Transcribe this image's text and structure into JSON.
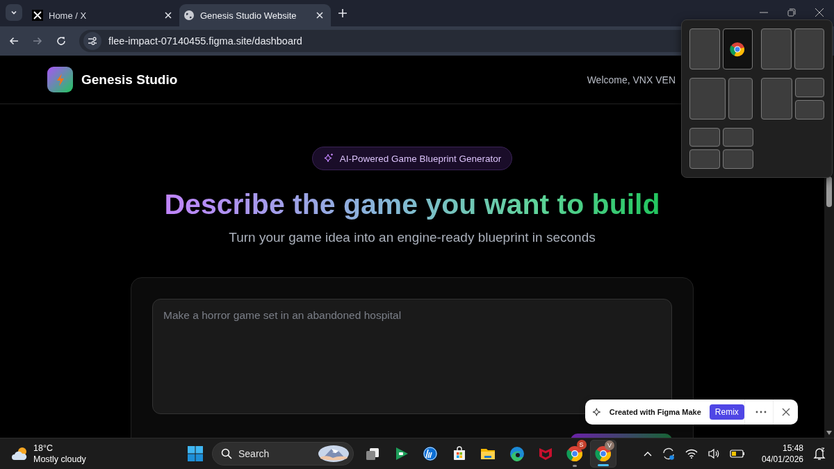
{
  "browser": {
    "tabs": [
      {
        "label": "Home / X",
        "kind": "x",
        "selected": false
      },
      {
        "label": "Genesis Studio Website",
        "kind": "globe",
        "selected": true
      }
    ],
    "address": "flee-impact-07140455.figma.site/dashboard"
  },
  "site": {
    "brand": "Genesis Studio",
    "welcome": "Welcome, VNX VEN",
    "badge": "AI-Powered Game Blueprint Generator",
    "heading": "Describe the game you want to build",
    "subheading": "Turn your game idea into an engine-ready blueprint in seconds",
    "prompt": {
      "placeholder": "Make a horror game set in an abandoned hospital"
    }
  },
  "toast": {
    "text": "Created with Figma Make",
    "button": "Remix"
  },
  "taskbar": {
    "weather": {
      "temperature": "18°C",
      "condition": "Mostly cloudy"
    },
    "search": {
      "placeholder": "Search"
    },
    "apps": [
      {
        "kind": "taskview",
        "running": false,
        "selected": false
      },
      {
        "kind": "games",
        "running": false,
        "selected": false
      },
      {
        "kind": "hp",
        "running": false,
        "selected": false
      },
      {
        "kind": "store",
        "running": false,
        "selected": false
      },
      {
        "kind": "files",
        "running": false,
        "selected": false
      },
      {
        "kind": "edge",
        "running": false,
        "selected": false
      },
      {
        "kind": "shield",
        "running": false,
        "selected": false
      },
      {
        "kind": "chrome",
        "badge": "S",
        "running": true,
        "selected": false
      },
      {
        "kind": "chrome",
        "badge": "V",
        "running": true,
        "selected": true
      }
    ],
    "clock": {
      "time": "15:48",
      "date": "04/01/2026"
    }
  }
}
